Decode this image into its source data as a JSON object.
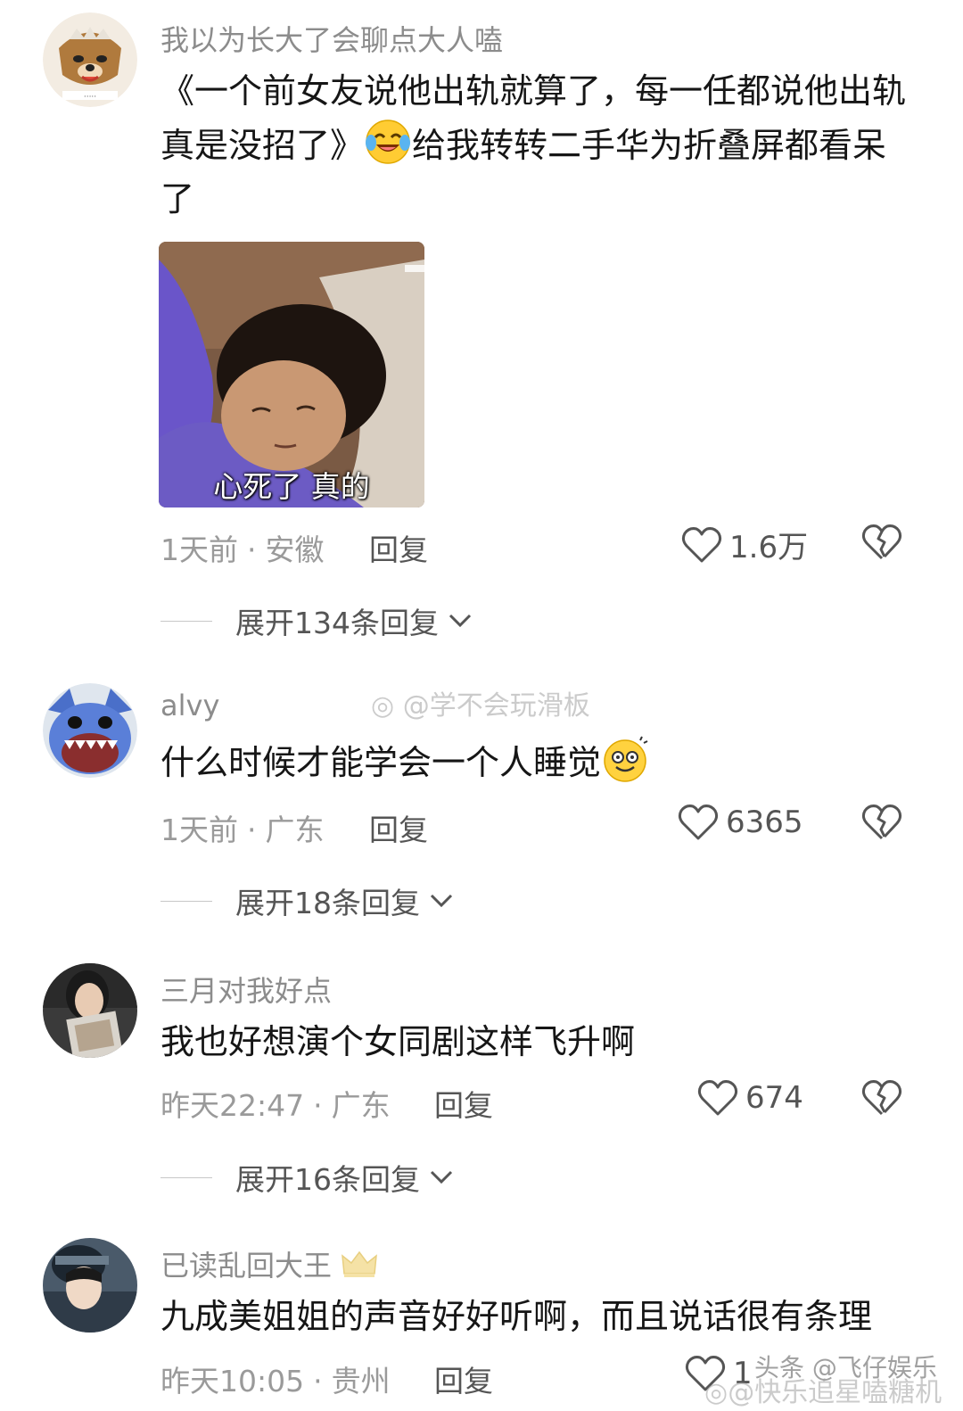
{
  "comments": [
    {
      "username": "我以为长大了会聊点大人嗑",
      "text_before_emoji": "《一个前女友说他出轨就算了，每一任都说他出轨真是没招了》",
      "emoji": "crying-laughing-emoji",
      "text_after_emoji": "给我转转二手华为折叠屏都看呆了",
      "image_caption": "心死了 真的",
      "time": "1天前",
      "location": "安徽",
      "reply_label": "回复",
      "likes": "1.6万",
      "expand_label": "展开134条回复"
    },
    {
      "username": "alvy",
      "text_before_emoji": "什么时候才能学会一个人睡觉",
      "emoji": "dizzy-smile-emoji",
      "text_after_emoji": "",
      "time": "1天前",
      "location": "广东",
      "reply_label": "回复",
      "likes": "6365",
      "expand_label": "展开18条回复"
    },
    {
      "username": "三月对我好点",
      "text_before_emoji": "我也好想演个女同剧这样飞升啊",
      "text_after_emoji": "",
      "time": "昨天22:47",
      "location": "广东",
      "reply_label": "回复",
      "likes": "674",
      "expand_label": "展开16条回复"
    },
    {
      "username": "已读乱回大王",
      "badge": "crown-icon",
      "text_before_emoji": "九成美姐姐的声音好好听啊，而且说话很有条理",
      "text_after_emoji": "",
      "time": "昨天10:05",
      "location": "贵州",
      "reply_label": "回复",
      "likes": "1"
    }
  ],
  "watermarks": {
    "middle": "@学不会玩滑板",
    "bottom": "头条 @飞仔娱乐",
    "bottom_overlay": "@快乐追星嗑糖机"
  },
  "colors": {
    "text": "#161616",
    "secondary": "#8c8c8c",
    "icon": "#555555"
  }
}
